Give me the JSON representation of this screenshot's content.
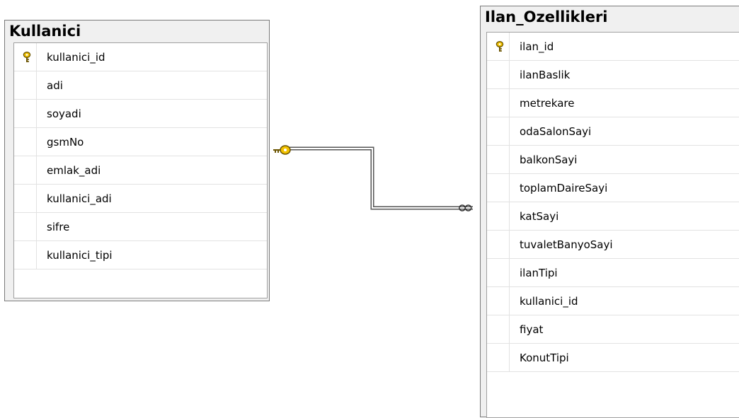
{
  "tables": [
    {
      "title": "Kullanici",
      "columns": [
        {
          "name": "kullanici_id",
          "primary_key": true
        },
        {
          "name": "adi",
          "primary_key": false
        },
        {
          "name": "soyadi",
          "primary_key": false
        },
        {
          "name": "gsmNo",
          "primary_key": false
        },
        {
          "name": "emlak_adi",
          "primary_key": false
        },
        {
          "name": "kullanici_adi",
          "primary_key": false
        },
        {
          "name": "sifre",
          "primary_key": false
        },
        {
          "name": "kullanici_tipi",
          "primary_key": false
        }
      ]
    },
    {
      "title": "Ilan_Ozellikleri",
      "columns": [
        {
          "name": "ilan_id",
          "primary_key": true
        },
        {
          "name": "ilanBaslik",
          "primary_key": false
        },
        {
          "name": "metrekare",
          "primary_key": false
        },
        {
          "name": "odaSalonSayi",
          "primary_key": false
        },
        {
          "name": "balkonSayi",
          "primary_key": false
        },
        {
          "name": "toplamDaireSayi",
          "primary_key": false
        },
        {
          "name": "katSayi",
          "primary_key": false
        },
        {
          "name": "tuvaletBanyoSayi",
          "primary_key": false
        },
        {
          "name": "ilanTipi",
          "primary_key": false
        },
        {
          "name": "kullanici_id",
          "primary_key": false
        },
        {
          "name": "fiyat",
          "primary_key": false
        },
        {
          "name": "KonutTipi",
          "primary_key": false
        }
      ]
    }
  ],
  "relationship": {
    "from": "Kullanici",
    "to": "Ilan_Ozellikleri",
    "from_end": "key-icon",
    "to_end": "infinity-icon"
  },
  "colors": {
    "key": "#f2c200",
    "key_outline": "#6b5400",
    "border": "#7a7a7a",
    "header_bg": "#f0f0f0"
  }
}
